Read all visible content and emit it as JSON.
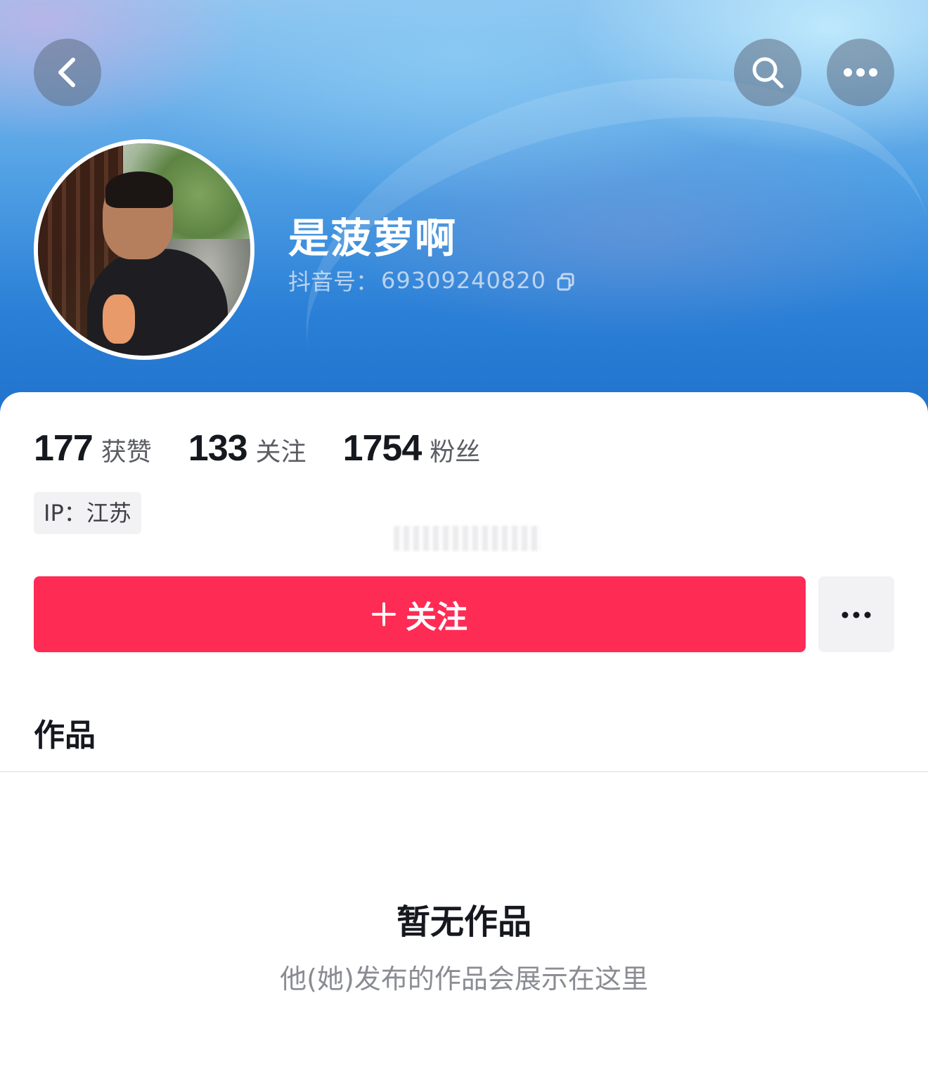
{
  "header": {
    "back_icon": "chevron-left-icon",
    "search_icon": "search-icon",
    "more_icon": "more-horizontal-icon"
  },
  "profile": {
    "nickname": "是菠萝啊",
    "id_label": "抖音号：",
    "id_value": "69309240820",
    "copy_icon": "copy-icon"
  },
  "stats": [
    {
      "value": "177",
      "label": "获赞"
    },
    {
      "value": "133",
      "label": "关注"
    },
    {
      "value": "1754",
      "label": "粉丝"
    }
  ],
  "ip_location": "IP：江苏",
  "actions": {
    "follow_label": "关注",
    "follow_color": "#fe2c55"
  },
  "tabs": {
    "works_label": "作品"
  },
  "empty_state": {
    "title": "暂无作品",
    "subtitle": "他(她)发布的作品会展示在这里"
  }
}
